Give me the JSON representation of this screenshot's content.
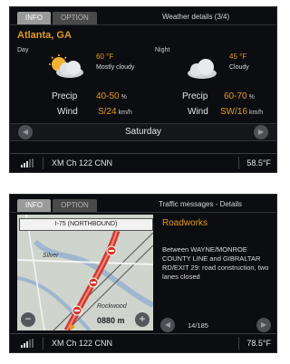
{
  "weather": {
    "tabs": [
      "INFO",
      "OPTION"
    ],
    "title": "Weather details (3/4)",
    "location": "Atlanta, GA",
    "day": {
      "label": "Day",
      "temp": "60 °F",
      "condition": "Mostly cloudy",
      "precip": "40-50",
      "wind": "S/24"
    },
    "night": {
      "label": "Night",
      "temp": "45 °F",
      "condition": "Cloudy",
      "precip": "60-70",
      "wind": "SW/16"
    },
    "precip_label": "Precip",
    "wind_label": "Wind",
    "precip_unit": "%",
    "wind_unit": "km/h",
    "weekday": "Saturday",
    "icons": {
      "day": "partly-cloudy-sun-icon",
      "night": "cloud-icon",
      "prev": "chevron-left-icon",
      "next": "chevron-right-icon"
    }
  },
  "traffic": {
    "tabs": [
      "INFO",
      "OPTION"
    ],
    "title": "Traffic messages - Details",
    "road": "I-75 (NORTHBOUND)",
    "map_labels": [
      "Silver",
      "Rockwood"
    ],
    "distance": "0880 m",
    "event": "Roadworks",
    "message": "Between WAYNE/MONROE COUNTY LINE and GIBRALTAR RD/EXIT 29: road construction, two lanes closed",
    "pager": "14/185",
    "colors": {
      "accent": "#e39a24",
      "route": "#d23a2e"
    }
  },
  "status1": {
    "radio": "XM  Ch 122 CNN",
    "temp": "58.5°F"
  },
  "status2": {
    "radio": "XM  Ch 122 CNN",
    "temp": "78.5°F"
  }
}
